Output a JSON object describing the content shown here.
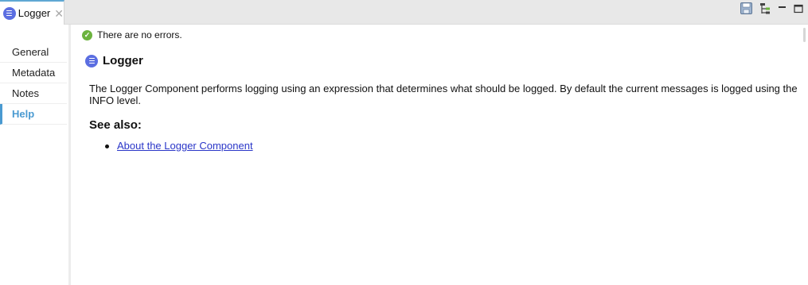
{
  "tab": {
    "label": "Logger",
    "close": "✕"
  },
  "toolbar": {
    "icons": [
      "save-icon",
      "tree-icon",
      "minimize-icon",
      "maximize-icon"
    ]
  },
  "sidebar": {
    "items": [
      {
        "label": "General"
      },
      {
        "label": "Metadata"
      },
      {
        "label": "Notes"
      },
      {
        "label": "Help",
        "active": true
      }
    ]
  },
  "main": {
    "status": "There are no errors.",
    "title": "Logger",
    "description": "The Logger Component performs logging using an expression that determines what should be logged. By default the current messages is logged using the INFO level.",
    "see_also_heading": "See also:",
    "links": [
      {
        "label": "About the Logger Component"
      }
    ]
  },
  "colors": {
    "accent": "#4a9ad1",
    "logger_icon": "#5b6ee1",
    "status_ok": "#6cb33e",
    "link": "#2a36c8"
  }
}
